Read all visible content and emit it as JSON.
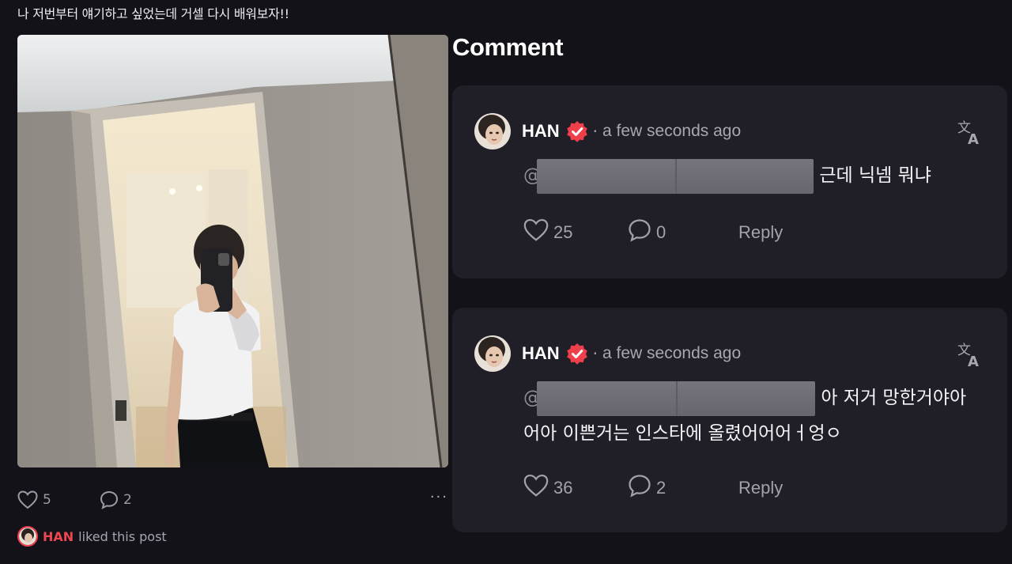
{
  "post": {
    "caption": "나 저번부터 얘기하고 싶었는데 거셀 다시 배워보자!!",
    "likes": "5",
    "comments": "2",
    "more": "···",
    "liked_by_user": "HAN",
    "liked_by_text": "liked this post"
  },
  "comments_section": {
    "title": "Comment",
    "items": [
      {
        "user": "HAN",
        "dot": "·",
        "time": "a few seconds ago",
        "mention_symbol": "@",
        "text_lines": [
          "근데 닉넴 뭐냐"
        ],
        "likes": "25",
        "replies": "0",
        "reply_label": "Reply"
      },
      {
        "user": "HAN",
        "dot": "·",
        "time": "a few seconds ago",
        "mention_symbol": "@",
        "text_lines": [
          "아 저거 망한거야아",
          "어아 이쁜거는 인스타에 올렸어어어ㅓ엉ㅇ"
        ],
        "likes": "36",
        "replies": "2",
        "reply_label": "Reply"
      }
    ]
  },
  "colors": {
    "background": "#131218",
    "card": "#201f28",
    "accent_red": "#ef3f4b",
    "muted_text": "#a4a1ad"
  },
  "icons": [
    "heart-icon",
    "comment-bubble-icon",
    "verified-badge-icon",
    "translate-icon",
    "more-options-icon"
  ]
}
